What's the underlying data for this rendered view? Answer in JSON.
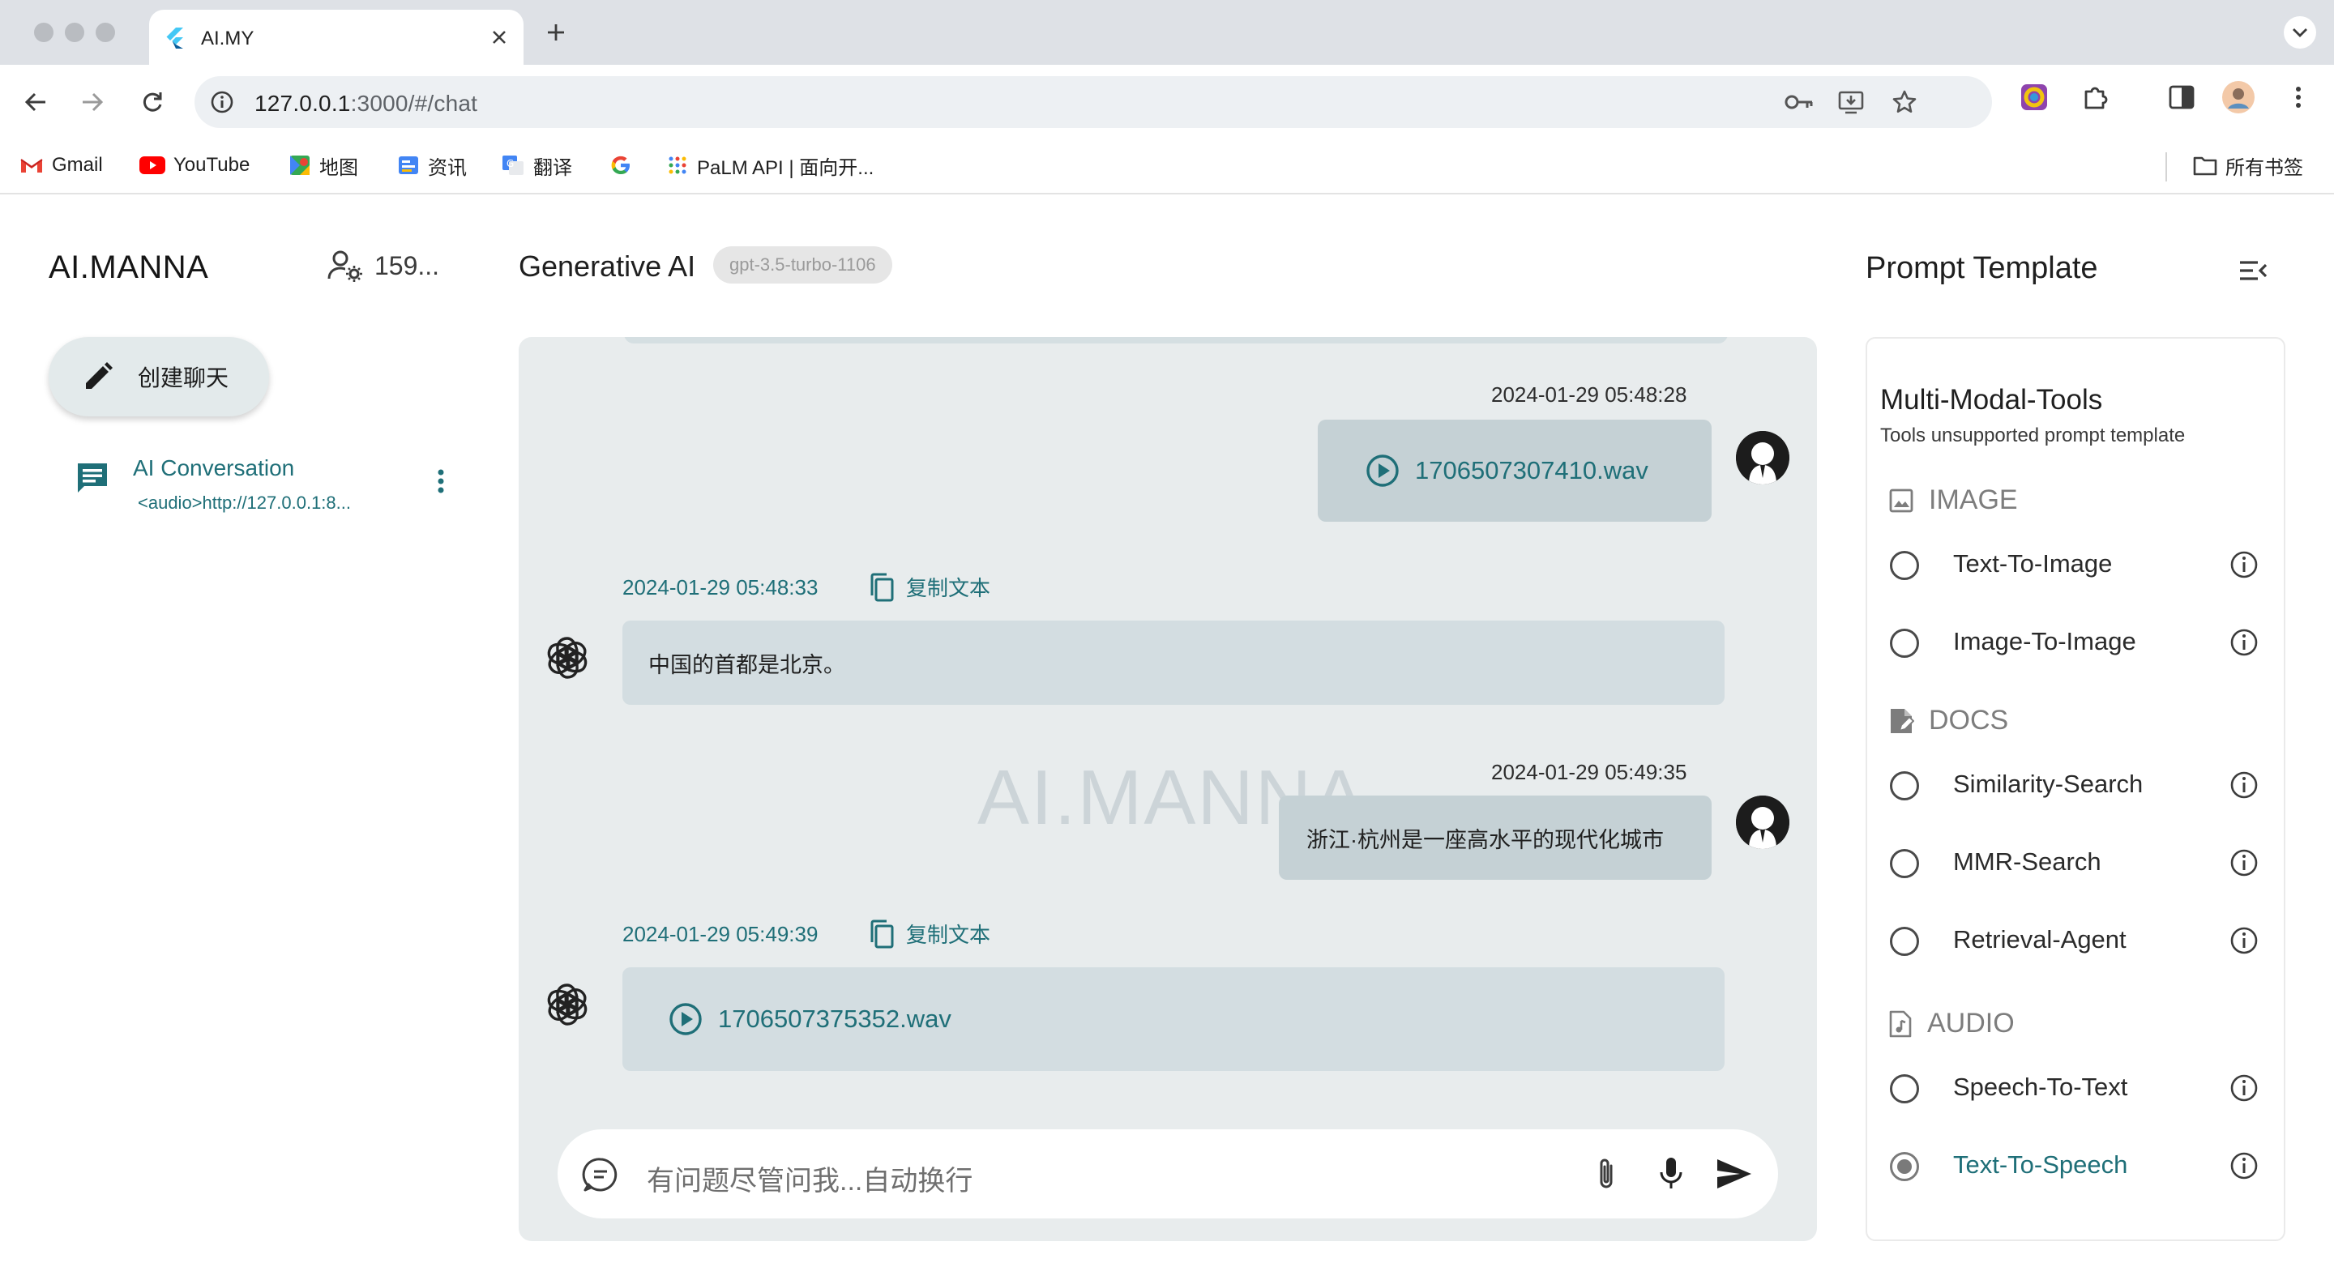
{
  "browser": {
    "tab_title": "AI.MY",
    "url_host": "127.0.0.1",
    "url_path": ":3000/#/chat",
    "bookmarks": [
      {
        "label": "Gmail",
        "icon": "gmail-icon"
      },
      {
        "label": "YouTube",
        "icon": "youtube-icon"
      },
      {
        "label": "地图",
        "icon": "maps-icon"
      },
      {
        "label": "资讯",
        "icon": "news-icon"
      },
      {
        "label": "翻译",
        "icon": "translate-icon"
      },
      {
        "label": "",
        "icon": "google-icon"
      },
      {
        "label": "PaLM API | 面向开...",
        "icon": "palm-icon"
      }
    ],
    "all_bookmarks_label": "所有书签"
  },
  "sidebar": {
    "brand": "AI.MANNA",
    "user_count": "159...",
    "new_chat_label": "创建聊天",
    "conversations": [
      {
        "title": "AI Conversation",
        "preview": "<audio>http://127.0.0.1:8..."
      }
    ]
  },
  "chat": {
    "title": "Generative AI",
    "model": "gpt-3.5-turbo-1106",
    "watermark": "AI.MANNA",
    "copy_label": "复制文本",
    "messages": [
      {
        "role": "user",
        "time": "2024-01-29 05:48:28",
        "audio": "1706507307410.wav"
      },
      {
        "role": "ai",
        "time": "2024-01-29 05:48:33",
        "text": "中国的首都是北京。"
      },
      {
        "role": "user",
        "time": "2024-01-29 05:49:35",
        "text": "浙江·杭州是一座高水平的现代化城市"
      },
      {
        "role": "ai",
        "time": "2024-01-29 05:49:39",
        "audio": "1706507375352.wav"
      }
    ],
    "input_placeholder": "有问题尽管问我...自动换行"
  },
  "prompt_panel": {
    "title": "Prompt Template",
    "card_title": "Multi-Modal-Tools",
    "card_subtitle": "Tools unsupported prompt template",
    "sections": [
      {
        "name": "IMAGE",
        "icon": "image-icon",
        "tools": [
          {
            "label": "Text-To-Image",
            "selected": false
          },
          {
            "label": "Image-To-Image",
            "selected": false
          }
        ]
      },
      {
        "name": "DOCS",
        "icon": "document-icon",
        "tools": [
          {
            "label": "Similarity-Search",
            "selected": false
          },
          {
            "label": "MMR-Search",
            "selected": false
          },
          {
            "label": "Retrieval-Agent",
            "selected": false
          }
        ]
      },
      {
        "name": "AUDIO",
        "icon": "audio-file-icon",
        "tools": [
          {
            "label": "Speech-To-Text",
            "selected": false
          },
          {
            "label": "Text-To-Speech",
            "selected": true
          }
        ]
      }
    ]
  },
  "colors": {
    "accent": "#1f6f78",
    "chat_bg": "#e8eced",
    "user_bubble": "#c5d1d5",
    "ai_bubble": "#d3dde1"
  }
}
